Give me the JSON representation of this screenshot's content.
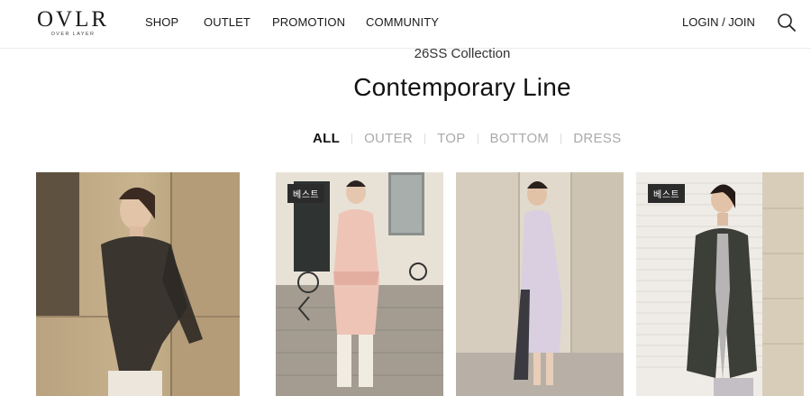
{
  "header": {
    "logo_main": "OVLR",
    "logo_sub": "OVER LAYER",
    "nav": [
      "SHOP",
      "OUTLET",
      "PROMOTION",
      "COMMUNITY"
    ],
    "login": "LOGIN / JOIN",
    "search_icon": "search-icon"
  },
  "section": {
    "subtitle": "26SS Collection",
    "title": "Contemporary Line"
  },
  "tabs": [
    "ALL",
    "OUTER",
    "TOP",
    "BOTTOM",
    "DRESS"
  ],
  "active_tab": "ALL",
  "products": [
    {
      "badge": ""
    },
    {
      "badge": "베스트"
    },
    {
      "badge": ""
    },
    {
      "badge": "베스트"
    }
  ],
  "colors": {
    "badge_bg": "#2b2b2b",
    "tab_inactive": "#aaaaaa",
    "tab_active": "#111111"
  }
}
